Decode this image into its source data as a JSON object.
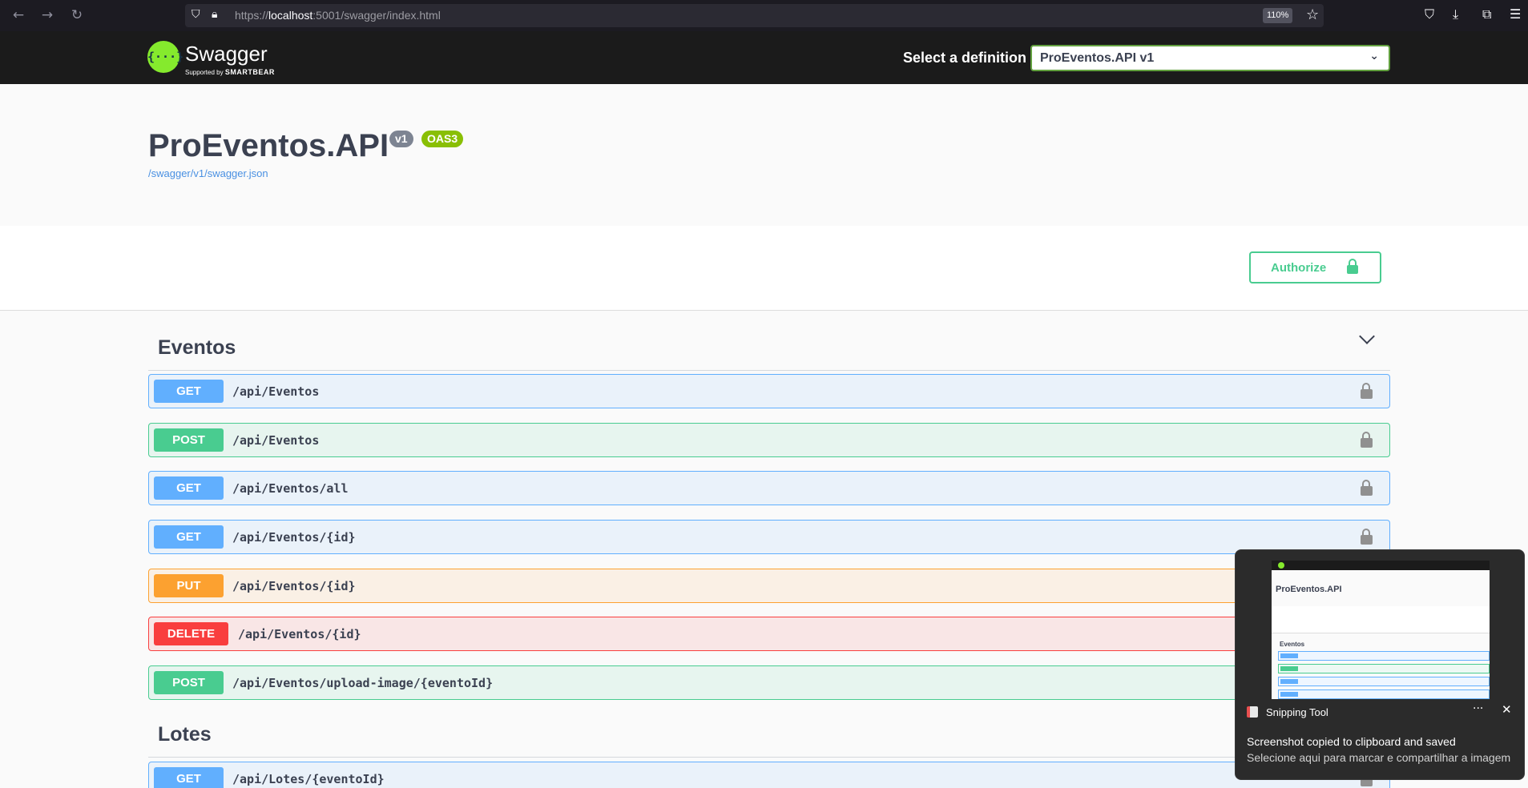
{
  "browser": {
    "back_icon": "←",
    "forward_icon": "→",
    "reload_icon": "↻",
    "url_prefix": "https://",
    "url_host": "localhost",
    "url_rest": ":5001/swagger/index.html",
    "zoom": "110%"
  },
  "topbar": {
    "logo_text": "Swagger",
    "logo_symbol": "{···}",
    "logo_sub_prefix": "Supported by",
    "logo_sub_brand": "SMARTBEAR",
    "definition_label": "Select a definition",
    "definition_value": "ProEventos.API v1"
  },
  "info": {
    "title": "ProEventos.API",
    "version_badge": "v1",
    "oas_badge": "OAS3",
    "spec_link": "/swagger/v1/swagger.json"
  },
  "authorize_label": "Authorize",
  "tags": [
    {
      "name": "Eventos",
      "operations": [
        {
          "method": "GET",
          "path": "/api/Eventos"
        },
        {
          "method": "POST",
          "path": "/api/Eventos"
        },
        {
          "method": "GET",
          "path": "/api/Eventos/all"
        },
        {
          "method": "GET",
          "path": "/api/Eventos/{id}"
        },
        {
          "method": "PUT",
          "path": "/api/Eventos/{id}"
        },
        {
          "method": "DELETE",
          "path": "/api/Eventos/{id}"
        },
        {
          "method": "POST",
          "path": "/api/Eventos/upload-image/{eventoId}"
        }
      ]
    },
    {
      "name": "Lotes",
      "operations": [
        {
          "method": "GET",
          "path": "/api/Lotes/{eventoId}"
        }
      ]
    }
  ],
  "toast": {
    "app_name": "Snipping Tool",
    "more_icon": "···",
    "close_icon": "✕",
    "message": "Screenshot copied to clipboard and saved",
    "sub_message": "Selecione aqui para marcar e compartilhar a imagem",
    "thumb_title": "ProEventos.API",
    "thumb_tag": "Eventos"
  },
  "colors": {
    "get": "#61affe",
    "post": "#49cc90",
    "put": "#fca130",
    "delete": "#f93e3e",
    "swagger_green": "#85ea2d",
    "topbar": "#1b1b1b"
  }
}
